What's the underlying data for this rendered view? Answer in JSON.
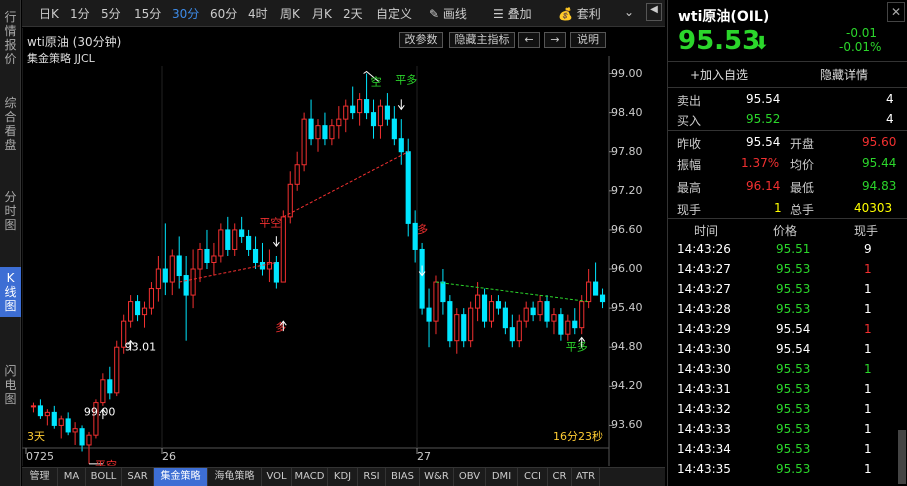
{
  "leftnav": [
    {
      "label": "行情报价",
      "active": false
    },
    {
      "label": "综合看盘",
      "active": false
    },
    {
      "label": "分时图",
      "active": false
    },
    {
      "label": "K线图",
      "active": true
    },
    {
      "label": "闪电图",
      "active": false
    }
  ],
  "toolbar": {
    "periods": [
      "日K",
      "1分",
      "5分",
      "15分",
      "30分",
      "60分",
      "4时",
      "周K",
      "月K",
      "2天",
      "自定义"
    ],
    "active_period": "30分",
    "draw_label": "画线",
    "overlay_label": "叠加",
    "arb_label": "套利"
  },
  "chart_header": {
    "title": "wti原油 (30分钟)",
    "strategy": "集金策略 JJCL",
    "btn_params": "改参数",
    "btn_hide": "隐藏主指标",
    "btn_left": "←",
    "btn_right": "→",
    "btn_help": "说明"
  },
  "chart_data": {
    "type": "candlestick",
    "y_ticks": [
      "99.00",
      "98.40",
      "97.80",
      "97.20",
      "96.60",
      "96.00",
      "95.40",
      "94.80",
      "94.20",
      "93.60"
    ],
    "ylim": [
      93.1,
      99.1
    ],
    "x_labels": [
      "0725",
      "26",
      "27"
    ],
    "annotations": [
      {
        "text": "99.00",
        "kind": "high"
      },
      {
        "text": "93.01",
        "kind": "low"
      },
      {
        "text": "平空",
        "color": "#f23030"
      },
      {
        "text": "多",
        "color": "#f23030"
      },
      {
        "text": "平多",
        "color": "#2bd62b"
      },
      {
        "text": "多",
        "color": "#f23030"
      },
      {
        "text": "平多",
        "color": "#2bd62b"
      },
      {
        "text": "空",
        "color": "#2bd62b"
      },
      {
        "text": "平空",
        "color": "#f23030"
      }
    ],
    "corner_left": "3天",
    "corner_right": "16分23秒",
    "candles": [
      [
        93.9,
        93.95,
        93.8,
        93.9
      ],
      [
        93.9,
        94.0,
        93.7,
        93.75
      ],
      [
        93.75,
        93.85,
        93.6,
        93.8
      ],
      [
        93.8,
        93.9,
        93.55,
        93.6
      ],
      [
        93.6,
        93.75,
        93.4,
        93.7
      ],
      [
        93.7,
        93.8,
        93.45,
        93.5
      ],
      [
        93.5,
        93.65,
        93.3,
        93.55
      ],
      [
        93.55,
        93.6,
        93.2,
        93.3
      ],
      [
        93.3,
        93.5,
        93.01,
        93.45
      ],
      [
        93.45,
        94.0,
        93.4,
        93.95
      ],
      [
        93.95,
        94.4,
        93.9,
        94.3
      ],
      [
        94.3,
        94.5,
        94.0,
        94.1
      ],
      [
        94.1,
        94.9,
        94.05,
        94.8
      ],
      [
        94.8,
        95.3,
        94.7,
        95.2
      ],
      [
        95.2,
        95.6,
        95.1,
        95.5
      ],
      [
        95.5,
        95.6,
        95.2,
        95.3
      ],
      [
        95.3,
        95.5,
        95.1,
        95.4
      ],
      [
        95.4,
        95.8,
        95.3,
        95.7
      ],
      [
        95.7,
        96.2,
        95.5,
        96.0
      ],
      [
        96.0,
        96.7,
        95.6,
        95.8
      ],
      [
        95.8,
        96.3,
        95.6,
        96.2
      ],
      [
        96.2,
        96.5,
        95.7,
        95.9
      ],
      [
        95.9,
        96.2,
        94.9,
        95.6
      ],
      [
        95.6,
        96.3,
        95.4,
        96.0
      ],
      [
        96.0,
        96.4,
        95.8,
        96.3
      ],
      [
        96.3,
        96.6,
        96.0,
        96.1
      ],
      [
        96.1,
        96.4,
        95.9,
        96.2
      ],
      [
        96.2,
        96.7,
        96.1,
        96.6
      ],
      [
        96.6,
        96.8,
        96.2,
        96.3
      ],
      [
        96.3,
        96.7,
        96.2,
        96.6
      ],
      [
        96.6,
        96.8,
        96.4,
        96.5
      ],
      [
        96.5,
        96.6,
        96.2,
        96.3
      ],
      [
        96.3,
        96.5,
        96.0,
        96.1
      ],
      [
        96.1,
        96.4,
        95.9,
        96.0
      ],
      [
        96.0,
        96.3,
        95.8,
        96.1
      ],
      [
        96.1,
        96.2,
        95.7,
        95.8
      ],
      [
        95.8,
        96.9,
        95.8,
        96.8
      ],
      [
        96.8,
        97.5,
        96.7,
        97.3
      ],
      [
        97.3,
        97.8,
        97.2,
        97.6
      ],
      [
        97.6,
        98.4,
        97.5,
        98.3
      ],
      [
        98.3,
        98.6,
        97.9,
        98.0
      ],
      [
        98.0,
        98.3,
        97.8,
        98.2
      ],
      [
        98.2,
        98.4,
        97.9,
        98.0
      ],
      [
        98.0,
        98.3,
        97.9,
        98.2
      ],
      [
        98.2,
        98.5,
        98.0,
        98.3
      ],
      [
        98.3,
        98.6,
        98.1,
        98.5
      ],
      [
        98.5,
        98.8,
        98.3,
        98.4
      ],
      [
        98.4,
        98.7,
        98.2,
        98.6
      ],
      [
        98.6,
        99.0,
        98.3,
        98.4
      ],
      [
        98.4,
        98.6,
        98.0,
        98.2
      ],
      [
        98.2,
        98.6,
        98.0,
        98.5
      ],
      [
        98.5,
        98.7,
        98.2,
        98.3
      ],
      [
        98.3,
        98.5,
        97.9,
        98.0
      ],
      [
        98.0,
        98.3,
        97.6,
        97.8
      ],
      [
        97.8,
        98.0,
        96.5,
        96.7
      ],
      [
        96.7,
        96.9,
        96.1,
        96.3
      ],
      [
        96.3,
        96.4,
        95.3,
        95.4
      ],
      [
        95.4,
        95.7,
        94.8,
        95.2
      ],
      [
        95.2,
        95.9,
        95.0,
        95.8
      ],
      [
        95.8,
        96.0,
        95.3,
        95.5
      ],
      [
        95.5,
        95.6,
        94.8,
        94.9
      ],
      [
        94.9,
        95.4,
        94.7,
        95.3
      ],
      [
        95.3,
        95.4,
        94.8,
        94.9
      ],
      [
        94.9,
        95.5,
        94.8,
        95.4
      ],
      [
        95.4,
        95.8,
        95.2,
        95.6
      ],
      [
        95.6,
        95.7,
        95.1,
        95.2
      ],
      [
        95.2,
        95.6,
        95.1,
        95.5
      ],
      [
        95.5,
        95.6,
        95.3,
        95.4
      ],
      [
        95.4,
        95.5,
        95.0,
        95.1
      ],
      [
        95.1,
        95.3,
        94.8,
        94.9
      ],
      [
        94.9,
        95.3,
        94.8,
        95.2
      ],
      [
        95.2,
        95.5,
        95.1,
        95.4
      ],
      [
        95.4,
        95.5,
        95.2,
        95.3
      ],
      [
        95.3,
        95.6,
        95.2,
        95.5
      ],
      [
        95.5,
        95.6,
        95.1,
        95.2
      ],
      [
        95.2,
        95.4,
        95.0,
        95.3
      ],
      [
        95.3,
        95.4,
        94.9,
        95.0
      ],
      [
        95.0,
        95.3,
        94.9,
        95.2
      ],
      [
        95.2,
        95.4,
        95.0,
        95.1
      ],
      [
        95.1,
        95.6,
        95.0,
        95.5
      ],
      [
        95.5,
        96.0,
        95.4,
        95.8
      ],
      [
        95.8,
        96.1,
        95.6,
        95.6
      ],
      [
        95.6,
        95.7,
        95.4,
        95.5
      ]
    ]
  },
  "quote": {
    "name": "wti原油(OIL)",
    "price": "95.53",
    "arrow": "⬇",
    "change": "-0.01",
    "change_pct": "-0.01%",
    "add_fav": "+加入自选",
    "hide_detail": "隐藏详情",
    "sell_label": "卖出",
    "sell_price": "95.54",
    "sell_vol": "4",
    "buy_label": "买入",
    "buy_price": "95.52",
    "buy_vol": "4",
    "prev_close_label": "昨收",
    "prev_close": "95.54",
    "open_label": "开盘",
    "open": "95.60",
    "amp_label": "振幅",
    "amp": "1.37%",
    "avg_label": "均价",
    "avg": "95.44",
    "high_label": "最高",
    "high": "96.14",
    "low_label": "最低",
    "low": "94.83",
    "cur_vol_label": "现手",
    "cur_vol": "1",
    "total_vol_label": "总手",
    "total_vol": "40303",
    "col_time": "时间",
    "col_price": "价格",
    "col_vol": "现手"
  },
  "ticks": [
    {
      "time": "14:43:26",
      "price": "95.51",
      "vol": "9",
      "pc": "green",
      "vc": "white"
    },
    {
      "time": "14:43:27",
      "price": "95.53",
      "vol": "1",
      "pc": "green",
      "vc": "red"
    },
    {
      "time": "14:43:27",
      "price": "95.53",
      "vol": "1",
      "pc": "green",
      "vc": "white"
    },
    {
      "time": "14:43:28",
      "price": "95.53",
      "vol": "1",
      "pc": "green",
      "vc": "white"
    },
    {
      "time": "14:43:29",
      "price": "95.54",
      "vol": "1",
      "pc": "white",
      "vc": "red"
    },
    {
      "time": "14:43:30",
      "price": "95.54",
      "vol": "1",
      "pc": "white",
      "vc": "white"
    },
    {
      "time": "14:43:30",
      "price": "95.53",
      "vol": "1",
      "pc": "green",
      "vc": "green"
    },
    {
      "time": "14:43:31",
      "price": "95.53",
      "vol": "1",
      "pc": "green",
      "vc": "white"
    },
    {
      "time": "14:43:32",
      "price": "95.53",
      "vol": "1",
      "pc": "green",
      "vc": "white"
    },
    {
      "time": "14:43:33",
      "price": "95.53",
      "vol": "1",
      "pc": "green",
      "vc": "white"
    },
    {
      "time": "14:43:34",
      "price": "95.53",
      "vol": "1",
      "pc": "green",
      "vc": "white"
    },
    {
      "time": "14:43:35",
      "price": "95.53",
      "vol": "1",
      "pc": "green",
      "vc": "white"
    }
  ],
  "bottom_tabs": [
    "管理",
    "MA",
    "BOLL",
    "SAR",
    "集金策略",
    "海龟策略",
    "VOL",
    "MACD",
    "KDJ",
    "RSI",
    "BIAS",
    "W&R",
    "OBV",
    "DMI",
    "CCI",
    "CR",
    "ATR"
  ],
  "bottom_active": "集金策略"
}
